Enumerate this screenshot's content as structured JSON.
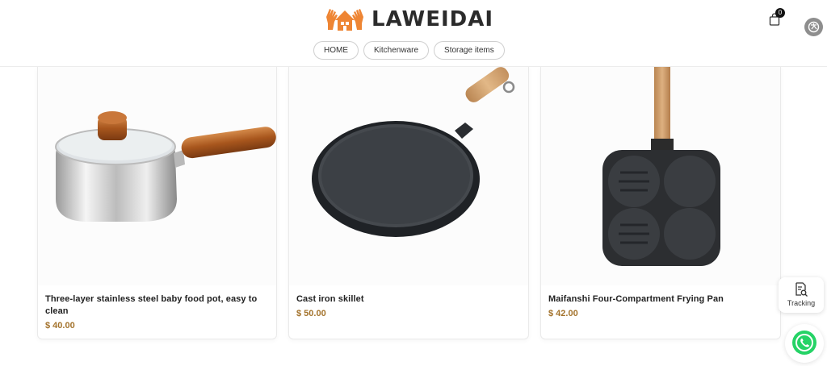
{
  "brand": {
    "name": "LAWEIDAI",
    "accent": "#ee8533"
  },
  "nav": [
    {
      "label": "HOME"
    },
    {
      "label": "Kitchenware"
    },
    {
      "label": "Storage items"
    }
  ],
  "cart": {
    "count": "0",
    "icon": "shopping-bag-icon"
  },
  "products": [
    {
      "title_line1": "Three-layer stainless steel baby food pot, easy to",
      "title_line2": "clean",
      "price": "$ 40.00"
    },
    {
      "title_line1": "Cast iron skillet",
      "title_line2": "",
      "price": "$ 50.00"
    },
    {
      "title_line1": "Maifanshi Four-Compartment Frying Pan",
      "title_line2": "",
      "price": "$ 42.00"
    }
  ],
  "tracking": {
    "label": "Tracking",
    "icon": "tracking-search-icon"
  },
  "whatsapp": {
    "icon": "whatsapp-icon",
    "color": "#25d366"
  },
  "price_color": "#a3722b"
}
